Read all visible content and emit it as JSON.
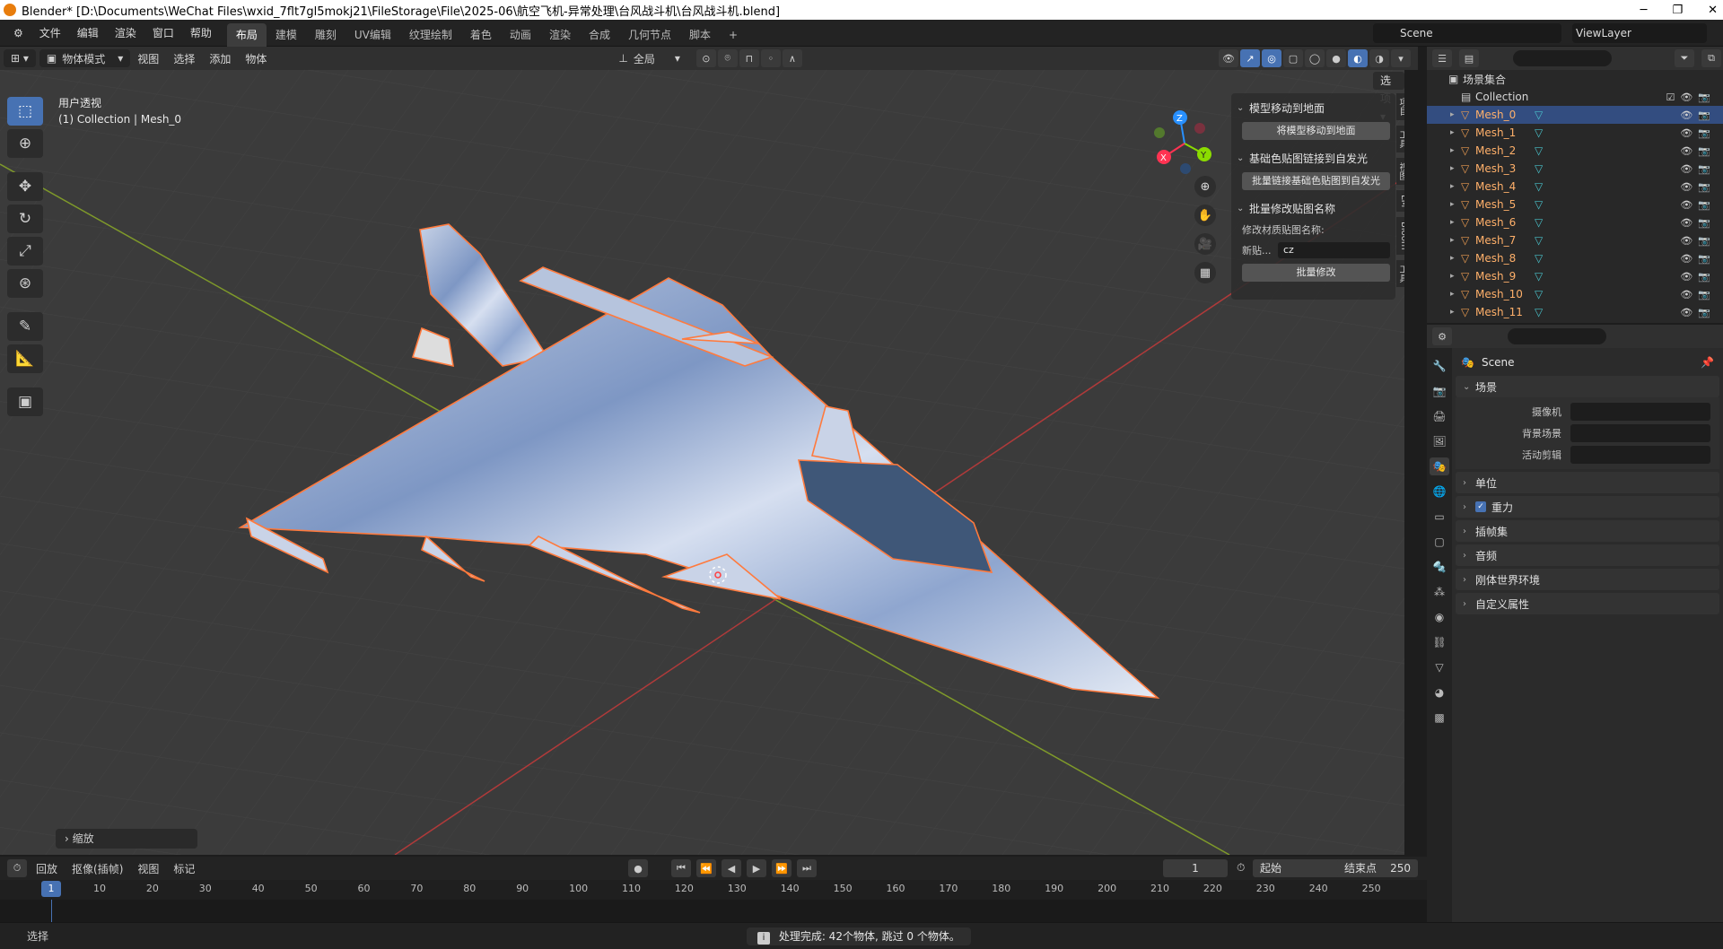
{
  "window": {
    "title": "Blender* [D:\\Documents\\WeChat Files\\wxid_7flt7gl5mokj21\\FileStorage\\File\\2025-06\\航空飞机-异常处理\\台风战斗机\\台风战斗机.blend]"
  },
  "menu": [
    "文件",
    "编辑",
    "渲染",
    "窗口",
    "帮助"
  ],
  "workspaces": [
    "布局",
    "建模",
    "雕刻",
    "UV编辑",
    "纹理绘制",
    "着色",
    "动画",
    "渲染",
    "合成",
    "几何节点",
    "脚本"
  ],
  "active_workspace": "布局",
  "scene_name": "Scene",
  "view_layer": "ViewLayer",
  "viewport_header": {
    "mode": "物体模式",
    "menus": [
      "视图",
      "选择",
      "添加",
      "物体"
    ],
    "transform_orientation": "全局",
    "options_label": "选项"
  },
  "viewport": {
    "view_name": "用户透视",
    "collection_info": "(1) Collection | Mesh_0",
    "last_operator": "缩放",
    "gizmo_axes": [
      "X",
      "Y",
      "Z"
    ]
  },
  "npanel": {
    "panels": [
      {
        "title": "模型移动到地面",
        "button": "将模型移动到地面"
      },
      {
        "title": "基础色贴图链接到自发光",
        "button": "批量链接基础色贴图到自发光"
      },
      {
        "title": "批量修改贴图名称",
        "label": "修改材质贴图名称:",
        "field_label": "新贴...",
        "field_value": "cz",
        "button": "批量修改"
      }
    ],
    "tabs": [
      "项目",
      "工具",
      "视图",
      "LM",
      "Bloom",
      "工具"
    ]
  },
  "outliner": {
    "root": "场景集合",
    "collection": "Collection",
    "items": [
      "Mesh_0",
      "Mesh_1",
      "Mesh_2",
      "Mesh_3",
      "Mesh_4",
      "Mesh_5",
      "Mesh_6",
      "Mesh_7",
      "Mesh_8",
      "Mesh_9",
      "Mesh_10",
      "Mesh_11"
    ],
    "selected": "Mesh_0"
  },
  "properties": {
    "scene_name": "Scene",
    "section_scene": "场景",
    "fields": [
      {
        "label": "摄像机"
      },
      {
        "label": "背景场景"
      },
      {
        "label": "活动剪辑"
      }
    ],
    "sections": [
      "单位",
      "重力",
      "插帧集",
      "音频",
      "刚体世界环境",
      "自定义属性"
    ],
    "gravity_checked": true
  },
  "timeline": {
    "menus": [
      "回放",
      "抠像(插帧)",
      "视图",
      "标记"
    ],
    "current_frame": "1",
    "start_label": "起始",
    "start": "1",
    "end_label": "结束点",
    "end": "250",
    "ticks": [
      "10",
      "20",
      "30",
      "40",
      "50",
      "60",
      "70",
      "80",
      "90",
      "100",
      "110",
      "120",
      "130",
      "140",
      "150",
      "160",
      "170",
      "180",
      "190",
      "200",
      "210",
      "220",
      "230",
      "240",
      "250"
    ]
  },
  "status": {
    "message": "处理完成: 42个物体, 跳过 0 个物体。",
    "select_label": "选择"
  },
  "colors": {
    "accent": "#4772b3",
    "selection_outline": "#ff7a3d",
    "x_axis": "#ff3352",
    "y_axis": "#8bdc00",
    "z_axis": "#2890ff"
  }
}
